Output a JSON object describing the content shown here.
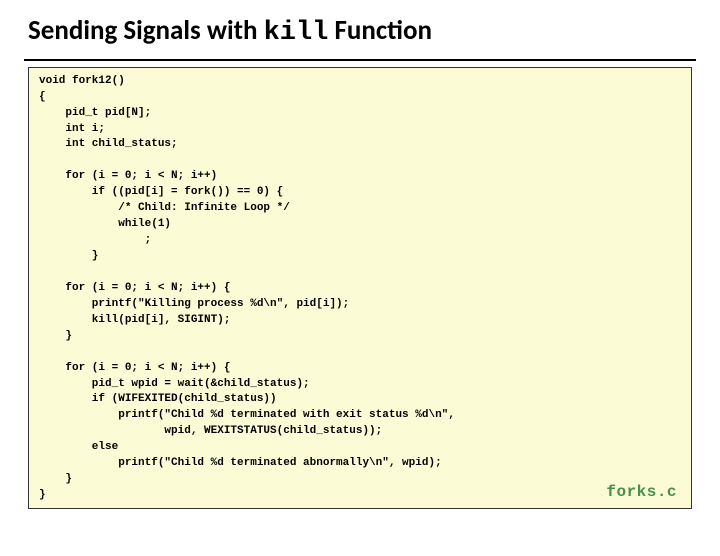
{
  "title": {
    "before": "Sending Signals with ",
    "code": "kill",
    "after": " Function"
  },
  "code": "void fork12()\n{\n    pid_t pid[N];\n    int i;\n    int child_status;\n\n    for (i = 0; i < N; i++)\n        if ((pid[i] = fork()) == 0) {\n            /* Child: Infinite Loop */\n            while(1)\n                ;\n        }\n\n    for (i = 0; i < N; i++) {\n        printf(\"Killing process %d\\n\", pid[i]);\n        kill(pid[i], SIGINT);\n    }\n\n    for (i = 0; i < N; i++) {\n        pid_t wpid = wait(&child_status);\n        if (WIFEXITED(child_status))\n            printf(\"Child %d terminated with exit status %d\\n\",\n                   wpid, WEXITSTATUS(child_status));\n        else\n            printf(\"Child %d terminated abnormally\\n\", wpid);\n    }\n}",
  "filename": "forks.c"
}
